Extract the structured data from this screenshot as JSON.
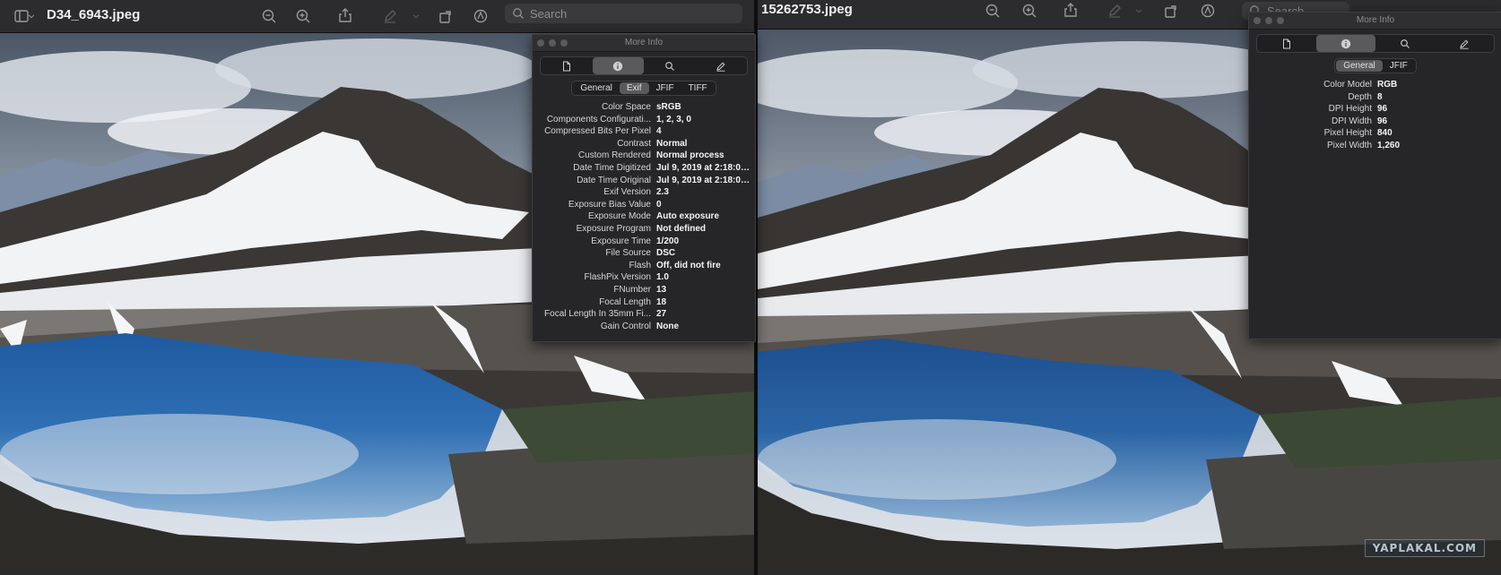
{
  "left_window": {
    "title": "D34_6943.jpeg",
    "search_placeholder": "Search",
    "info_panel": {
      "title": "More Info",
      "tabs": [
        "General",
        "Exif",
        "JFIF",
        "TIFF"
      ],
      "active_tab": "Exif",
      "rows": [
        {
          "key": "Color Space",
          "value": "sRGB"
        },
        {
          "key": "Components Configurati...",
          "value": "1, 2, 3, 0"
        },
        {
          "key": "Compressed Bits Per Pixel",
          "value": "4"
        },
        {
          "key": "Contrast",
          "value": "Normal"
        },
        {
          "key": "Custom Rendered",
          "value": "Normal process"
        },
        {
          "key": "Date Time Digitized",
          "value": "Jul 9, 2019 at 2:18:00..."
        },
        {
          "key": "Date Time Original",
          "value": "Jul 9, 2019 at 2:18:00..."
        },
        {
          "key": "Exif Version",
          "value": "2.3"
        },
        {
          "key": "Exposure Bias Value",
          "value": "0"
        },
        {
          "key": "Exposure Mode",
          "value": "Auto exposure"
        },
        {
          "key": "Exposure Program",
          "value": "Not defined"
        },
        {
          "key": "Exposure Time",
          "value": "1/200"
        },
        {
          "key": "File Source",
          "value": "DSC"
        },
        {
          "key": "Flash",
          "value": "Off, did not fire"
        },
        {
          "key": "FlashPix Version",
          "value": "1.0"
        },
        {
          "key": "FNumber",
          "value": "13"
        },
        {
          "key": "Focal Length",
          "value": "18"
        },
        {
          "key": "Focal Length In 35mm Fi...",
          "value": "27"
        },
        {
          "key": "Gain Control",
          "value": "None"
        }
      ]
    }
  },
  "right_window": {
    "title": "15262753.jpeg",
    "search_placeholder": "Search",
    "info_panel": {
      "title": "More Info",
      "tabs": [
        "General",
        "JFIF"
      ],
      "active_tab": "General",
      "rows": [
        {
          "key": "Color Model",
          "value": "RGB"
        },
        {
          "key": "Depth",
          "value": "8"
        },
        {
          "key": "DPI Height",
          "value": "96"
        },
        {
          "key": "DPI Width",
          "value": "96"
        },
        {
          "key": "Pixel Height",
          "value": "840"
        },
        {
          "key": "Pixel Width",
          "value": "1,260"
        }
      ]
    },
    "watermark": "YAPLAKAL.COM"
  },
  "icons": [
    "sidebar-icon",
    "chevron-down-icon",
    "zoom-out-icon",
    "zoom-in-icon",
    "share-icon",
    "markup-icon",
    "rotate-icon",
    "annotate-icon",
    "search-icon",
    "document-icon",
    "info-icon",
    "magnifier-icon",
    "pencil-icon"
  ]
}
